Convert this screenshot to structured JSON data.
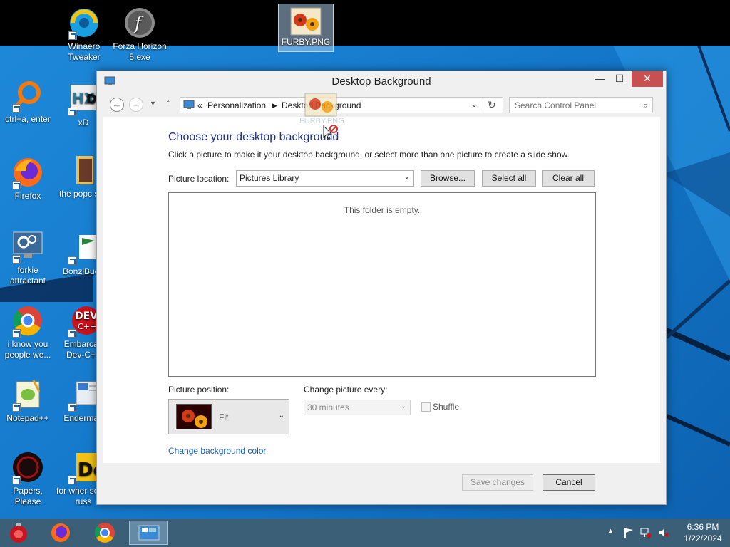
{
  "desktop": {
    "icons": [
      {
        "label": "Winaero Tweaker"
      },
      {
        "label": "Forza Horizon 5.exe"
      },
      {
        "label": "FURBY.PNG"
      },
      {
        "label": "ctrl+a, enter"
      },
      {
        "label": "xD"
      },
      {
        "label": "Firefox"
      },
      {
        "label": "the popc shit"
      },
      {
        "label": "forkie attractant"
      },
      {
        "label": "BonziBudd"
      },
      {
        "label": "i know you people we..."
      },
      {
        "label": "Embarcad Dev-C++"
      },
      {
        "label": "Notepad++"
      },
      {
        "label": "Enderman"
      },
      {
        "label": "Papers, Please"
      },
      {
        "label": "for wher some russ"
      }
    ],
    "drag_ghost_label": "FURBY.PNG"
  },
  "window": {
    "title": "Desktop Background",
    "controls": {
      "minimize": "—",
      "maximize": "☐",
      "close": "✕"
    },
    "address": {
      "prefix": "«",
      "crumbs": [
        "Personalization",
        "Desktop Background"
      ]
    },
    "search": {
      "placeholder": "Search Control Panel"
    },
    "heading": "Choose your desktop background",
    "subtext": "Click a picture to make it your desktop background, or select more than one picture to create a slide show.",
    "picture_location": {
      "label": "Picture location:",
      "value": "Pictures Library",
      "browse": "Browse...",
      "select_all": "Select all",
      "clear_all": "Clear all"
    },
    "empty_message": "This folder is empty.",
    "picture_position": {
      "label": "Picture position:",
      "value": "Fit"
    },
    "change_every": {
      "label": "Change picture every:",
      "value": "30 minutes"
    },
    "shuffle_label": "Shuffle",
    "bg_color_link": "Change background color",
    "save_label": "Save changes",
    "cancel_label": "Cancel"
  },
  "taskbar": {
    "clock_time": "6:36 PM",
    "clock_date": "1/22/2024"
  },
  "colors": {
    "wallpaper": "#1477c9",
    "taskbar": "#3c5f78",
    "heading": "#1e3287",
    "link": "#1a5fb4",
    "close_button": "#c75050"
  }
}
